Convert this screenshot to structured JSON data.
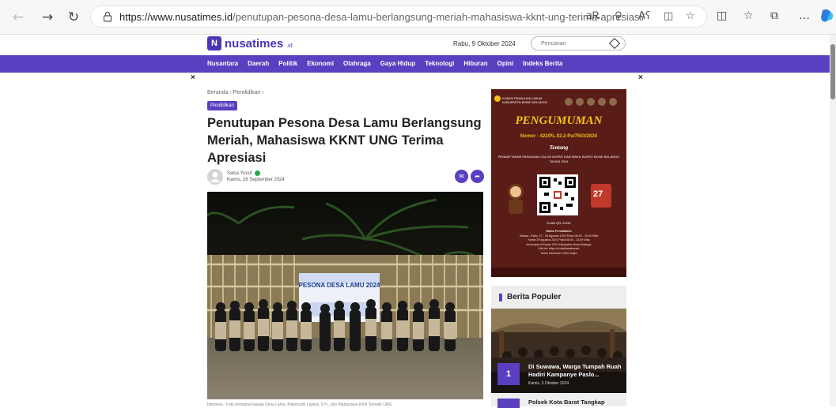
{
  "browser": {
    "url_domain": "https://www.nusatimes.id",
    "url_path": "/penutupan-pesona-desa-lamu-berlangsung-meriah-mahasiswa-kknt-ung-terima-apresiasi/",
    "read_aloud": "Aʕ",
    "more": "…"
  },
  "site": {
    "logo_text": "nusatimes",
    "logo_suffix": ".id",
    "date": "Rabu, 9 Oktober 2024",
    "search_placeholder": "Pencarian"
  },
  "nav": {
    "items": [
      "Nusantara",
      "Daerah",
      "Politik",
      "Ekonomi",
      "Olahraga",
      "Gaya Hidup",
      "Teknologi",
      "Hiburan",
      "Opini",
      "Indeks Berita"
    ]
  },
  "close_label": "×",
  "article": {
    "breadcrumb": "Beranda › Pendidikan ›",
    "category": "Pendidikan",
    "title": "Penutupan Pesona Desa Lamu Berlangsung Meriah, Mahasiswa KKNT UNG Terima Apresiasi",
    "author": "Salsa Yusuf",
    "date": "Kamis, 26 September 2024",
    "photo_banner_title": "PESONA DESA LAMU 2024",
    "caption": "Istimewa : Foto bersama Kepala Desa Lamu, Makmudin Lajima, S.H., dan Mahasiswa KKN Tematik UNG"
  },
  "ad": {
    "kpu_label": "KOMISI PEMILIHAN UMUM KABUPATEN BONE BOLANGO",
    "title": "PENGUMUMAN",
    "nomor": "Nomor : 422/PL.02.2-Pu/7503/2024",
    "tentang": "Tentang",
    "desc": "PENDAFTARAN PASANGAN CALON BUPATI DAN WAKIL BUPATI BONE BOLANGO TAHUN 2024",
    "scan": "SCAN QR CODE",
    "waktu_title": "Waktu Pendaftaran",
    "waktu_1": "Selasa - Rabu, 27 - 28 Agustus 2024 Pukul 08.00 - 16.00 Wita",
    "waktu_2": "Kamis 29 Agustus 2024 Pukul 08.00 - 23.59 Wita",
    "waktu_3": "bertempat di Kantor KPU Kabupaten Bone Bolango",
    "waktu_4": "Klik link https://s.id/pilkadaboneb",
    "waktu_5": "Untuk Informasi Lebih Lanjut",
    "badge_27": "27"
  },
  "populer": {
    "heading": "Berita Populer",
    "items": [
      {
        "rank": "1",
        "title": "Di Suwawa, Warga Tumpah Ruah Hadiri Kampanye Paslo...",
        "date": "Kamis, 3 Oktober 2024"
      },
      {
        "rank": "2",
        "title": "Polsek Kota Barat Tangkap"
      }
    ]
  }
}
